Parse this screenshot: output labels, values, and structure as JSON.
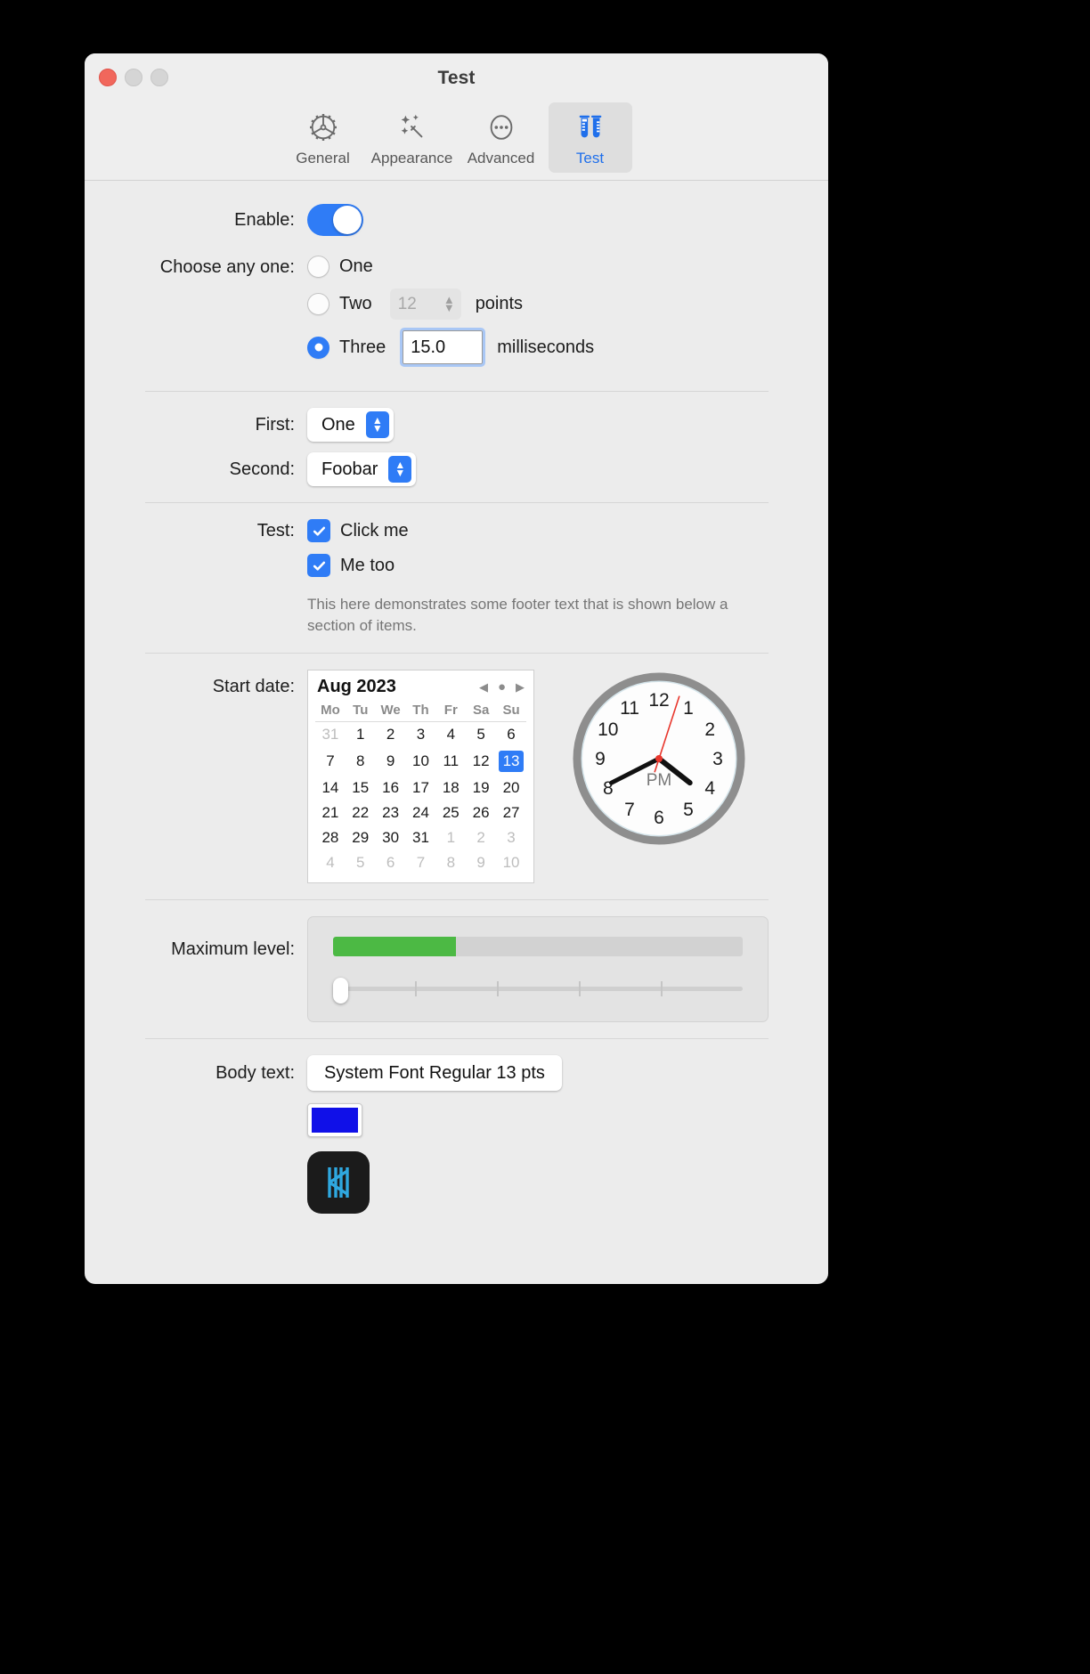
{
  "window": {
    "title": "Test",
    "traffic_lights": [
      "close",
      "minimize",
      "maximize"
    ]
  },
  "toolbar": {
    "tabs": [
      {
        "label": "General",
        "icon": "gear-icon",
        "selected": false
      },
      {
        "label": "Appearance",
        "icon": "wand-icon",
        "selected": false
      },
      {
        "label": "Advanced",
        "icon": "ellipsis-circle-icon",
        "selected": false
      },
      {
        "label": "Test",
        "icon": "test-tubes-icon",
        "selected": true
      }
    ]
  },
  "sections": {
    "enable": {
      "label": "Enable:",
      "toggle_on": true
    },
    "choose": {
      "label": "Choose any one:",
      "options": [
        {
          "label": "One",
          "selected": false
        },
        {
          "label": "Two",
          "selected": false
        },
        {
          "label": "Three",
          "selected": true
        }
      ],
      "stepper_value": "12",
      "stepper_unit": "points",
      "text_value": "15.0",
      "text_unit": "milliseconds"
    },
    "popups": {
      "first_label": "First:",
      "first_value": "One",
      "second_label": "Second:",
      "second_value": "Foobar"
    },
    "checks": {
      "label": "Test:",
      "items": [
        {
          "label": "Click me",
          "checked": true
        },
        {
          "label": "Me too",
          "checked": true
        }
      ],
      "footer": "This here demonstrates some footer text that is shown below a section of items."
    },
    "date": {
      "label": "Start date:",
      "month_year": "Aug 2023",
      "prev_icon": "triangle-left-icon",
      "today_icon": "dot-icon",
      "next_icon": "triangle-right-icon",
      "weekdays": [
        "Mo",
        "Tu",
        "We",
        "Th",
        "Fr",
        "Sa",
        "Su"
      ],
      "weeks": [
        [
          {
            "d": "31",
            "dim": true
          },
          {
            "d": "1"
          },
          {
            "d": "2"
          },
          {
            "d": "3"
          },
          {
            "d": "4"
          },
          {
            "d": "5"
          },
          {
            "d": "6"
          }
        ],
        [
          {
            "d": "7"
          },
          {
            "d": "8"
          },
          {
            "d": "9"
          },
          {
            "d": "10"
          },
          {
            "d": "11"
          },
          {
            "d": "12"
          },
          {
            "d": "13",
            "selected": true
          }
        ],
        [
          {
            "d": "14"
          },
          {
            "d": "15"
          },
          {
            "d": "16"
          },
          {
            "d": "17"
          },
          {
            "d": "18"
          },
          {
            "d": "19"
          },
          {
            "d": "20"
          }
        ],
        [
          {
            "d": "21"
          },
          {
            "d": "22"
          },
          {
            "d": "23"
          },
          {
            "d": "24"
          },
          {
            "d": "25"
          },
          {
            "d": "26"
          },
          {
            "d": "27"
          }
        ],
        [
          {
            "d": "28"
          },
          {
            "d": "29"
          },
          {
            "d": "30"
          },
          {
            "d": "31"
          },
          {
            "d": "1",
            "dim": true
          },
          {
            "d": "2",
            "dim": true
          },
          {
            "d": "3",
            "dim": true
          }
        ],
        [
          {
            "d": "4",
            "dim": true
          },
          {
            "d": "5",
            "dim": true
          },
          {
            "d": "6",
            "dim": true
          },
          {
            "d": "7",
            "dim": true
          },
          {
            "d": "8",
            "dim": true
          },
          {
            "d": "9",
            "dim": true
          },
          {
            "d": "10",
            "dim": true
          }
        ]
      ],
      "clock": {
        "hour_numerals": [
          "12",
          "1",
          "2",
          "3",
          "4",
          "5",
          "6",
          "7",
          "8",
          "9",
          "10",
          "11"
        ],
        "meridiem": "PM",
        "hour_angle": 128,
        "minute_angle": 243,
        "second_angle": 18
      }
    },
    "level": {
      "label": "Maximum level:",
      "progress_percent": 30,
      "slider_percent": 0,
      "tick_count": 4
    },
    "body": {
      "label": "Body text:",
      "font_button": "System Font Regular  13 pts",
      "color_value": "#1010e8",
      "app_icon": "app-icon"
    }
  },
  "colors": {
    "accent": "#2f7cf6",
    "progress_fill": "#4cb944",
    "window_bg": "#ececec"
  }
}
